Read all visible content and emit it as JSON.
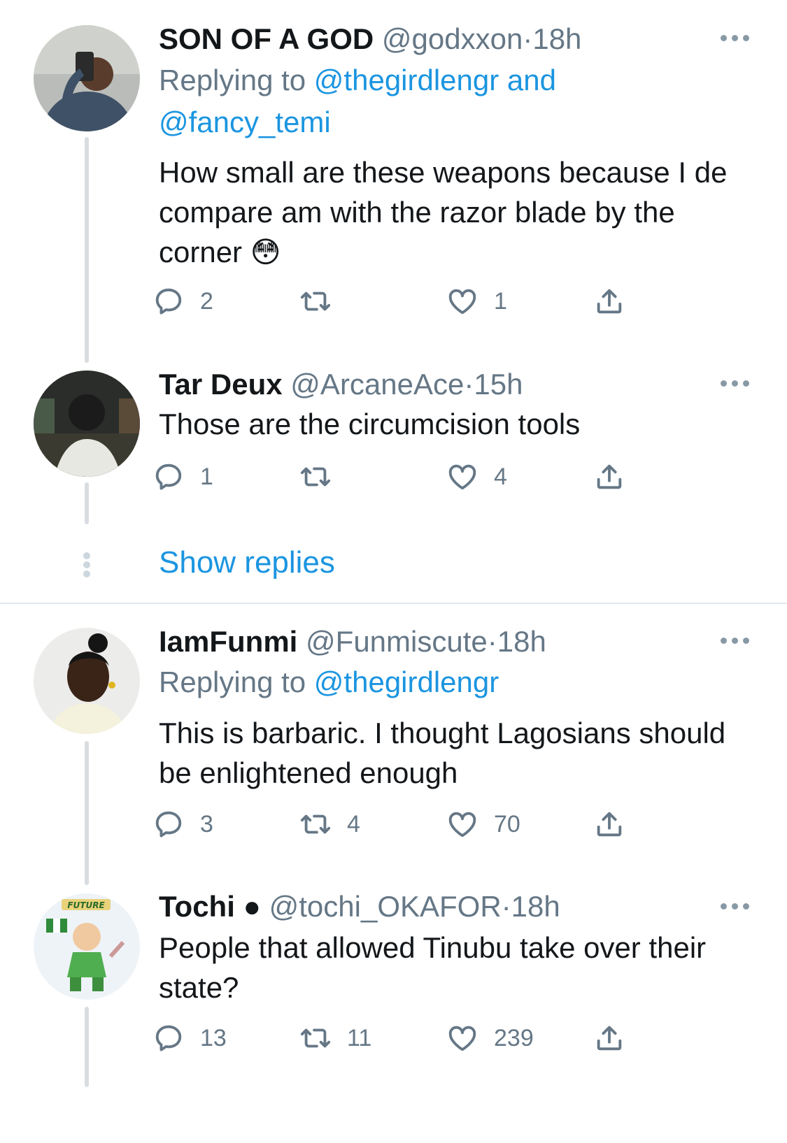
{
  "tweets": [
    {
      "name": "SON OF A GOD",
      "handle": "@godxxon",
      "sep": "·",
      "time": "18h",
      "replying_prefix": "Replying to",
      "replying_mentions": "@thegirdlengr and @fancy_temi",
      "text": "How small are these weapons because I de compare am with the razor blade by the corner 😳",
      "replies": "2",
      "retweets": "",
      "likes": "1"
    },
    {
      "name": "Tar Deux",
      "handle": "@ArcaneAce",
      "sep": "·",
      "time": "15h",
      "text": "Those are the circumcision tools",
      "replies": "1",
      "retweets": "",
      "likes": "4"
    },
    {
      "name": "IamFunmi",
      "handle": "@Funmiscute",
      "sep": "·",
      "time": "18h",
      "replying_prefix": "Replying to",
      "replying_mentions": "@thegirdlengr",
      "text": "This is barbaric. I thought Lagosians should be enlightened enough",
      "replies": "3",
      "retweets": "4",
      "likes": "70"
    },
    {
      "name": "Tochi",
      "name_badge": "●",
      "handle": "@tochi_OKAFOR",
      "sep": "·",
      "time": "18h",
      "text": "People that allowed Tinubu take over their state?",
      "replies": "13",
      "retweets": "11",
      "likes": "239"
    }
  ],
  "show_replies_label": "Show replies",
  "avatar4_text": "FUTURE",
  "colors": {
    "link": "#1b95e0",
    "secondary": "#657786",
    "thread_line": "#d9dde1"
  },
  "icons": {
    "reply": "reply-icon",
    "retweet": "retweet-icon",
    "like": "heart-icon",
    "share": "share-icon",
    "more": "more-icon"
  }
}
